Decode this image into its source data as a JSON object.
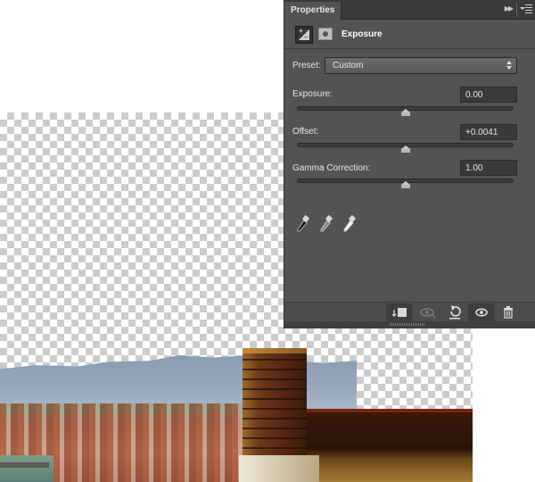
{
  "panel": {
    "tab_label": "Properties",
    "collapse_icon": "double-chevron-right",
    "menu_icon": "panel-menu",
    "header": {
      "adjustment_icon": "exposure-adjustment-icon",
      "mask_icon": "layer-mask-icon",
      "title": "Exposure"
    },
    "preset": {
      "label": "Preset:",
      "value": "Custom"
    },
    "controls": [
      {
        "label": "Exposure:",
        "value": "0.00",
        "slider_position": 0.5
      },
      {
        "label": "Offset:",
        "value": "+0.0041",
        "slider_position": 0.5
      },
      {
        "label": "Gamma Correction:",
        "value": "1.00",
        "slider_position": 0.5
      }
    ],
    "eyedroppers": [
      {
        "name": "black-point-eyedropper",
        "tone": "#1a1a1a"
      },
      {
        "name": "gray-point-eyedropper",
        "tone": "#8a8a8a"
      },
      {
        "name": "white-point-eyedropper",
        "tone": "#f0f0f0"
      }
    ],
    "footer_buttons": [
      {
        "name": "clip-to-layer-button",
        "icon": "clip-to-layer-icon",
        "active": true
      },
      {
        "name": "view-previous-state-button",
        "icon": "eye-previous-icon",
        "active": false
      },
      {
        "name": "reset-button",
        "icon": "reset-icon",
        "active": false
      },
      {
        "name": "toggle-visibility-button",
        "icon": "eye-icon",
        "active": true
      },
      {
        "name": "delete-button",
        "icon": "trash-icon",
        "active": false
      }
    ]
  },
  "canvas": {
    "background": "transparent-checkerboard",
    "image_content": "Florence cityscape with mountains and brick chimney"
  },
  "colors": {
    "panel_bg": "#535353",
    "field_bg": "#3a3a3a",
    "text": "#e6e6e6"
  }
}
